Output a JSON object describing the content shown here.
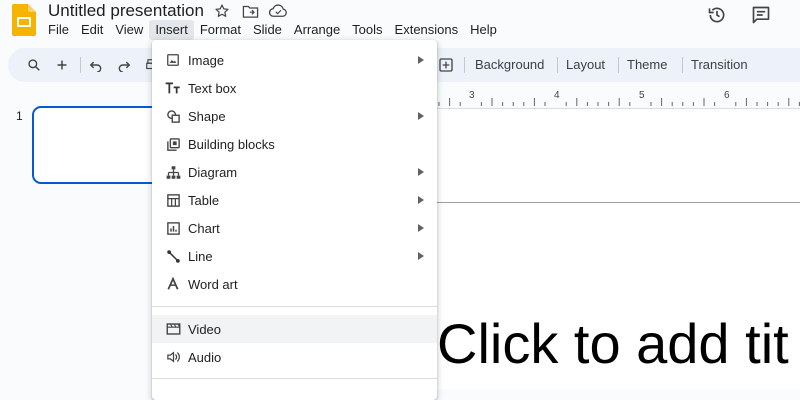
{
  "app": {
    "title": "Untitled presentation",
    "menubar": [
      "File",
      "Edit",
      "View",
      "Insert",
      "Format",
      "Slide",
      "Arrange",
      "Tools",
      "Extensions",
      "Help"
    ],
    "active_menu": "Insert"
  },
  "toolbar": {
    "background_label": "Background",
    "layout_label": "Layout",
    "theme_label": "Theme",
    "transition_label": "Transition"
  },
  "filmstrip": {
    "slide_number": "1"
  },
  "ruler": {
    "labels": [
      "3",
      "4",
      "5",
      "6"
    ]
  },
  "canvas": {
    "title_placeholder": "Click to add tit"
  },
  "insert_menu": {
    "items": [
      {
        "label": "Image",
        "icon": "image-icon",
        "submenu": true
      },
      {
        "label": "Text box",
        "icon": "text-box-icon",
        "submenu": false
      },
      {
        "label": "Shape",
        "icon": "shape-icon",
        "submenu": true
      },
      {
        "label": "Building blocks",
        "icon": "building-blocks-icon",
        "submenu": false
      },
      {
        "label": "Diagram",
        "icon": "diagram-icon",
        "submenu": true
      },
      {
        "label": "Table",
        "icon": "table-icon",
        "submenu": true
      },
      {
        "label": "Chart",
        "icon": "chart-icon",
        "submenu": true
      },
      {
        "label": "Line",
        "icon": "line-icon",
        "submenu": true
      },
      {
        "label": "Word art",
        "icon": "word-art-icon",
        "submenu": false
      },
      {
        "label": "Video",
        "icon": "video-icon",
        "submenu": false
      },
      {
        "label": "Audio",
        "icon": "audio-icon",
        "submenu": false
      }
    ]
  },
  "colors": {
    "accent": "#0b57d0",
    "logo": "#f4b400",
    "toolbar_bg": "#edf2fa"
  }
}
